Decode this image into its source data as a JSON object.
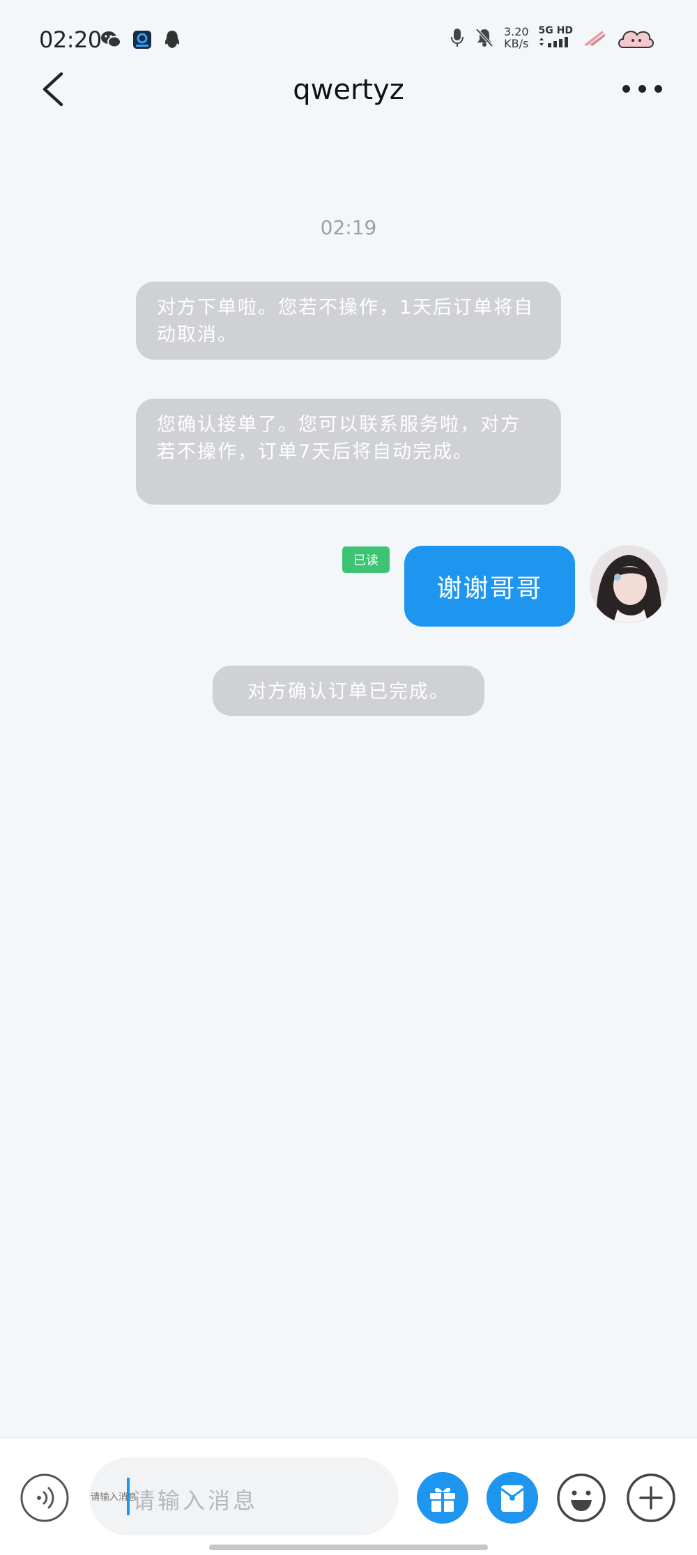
{
  "status_bar": {
    "time": "02:20",
    "speed_value": "3.20",
    "speed_unit": "KB/s",
    "network": "5G HD"
  },
  "header": {
    "title": "qwertyz"
  },
  "chat": {
    "timestamp": "02:19",
    "system_messages": [
      "对方下单啦。您若不操作，1天后订单将自动取消。",
      "您确认接单了。您可以联系服务啦，对方若不操作，订单7天后将自动完成。",
      "对方确认订单已完成。"
    ],
    "my_message": {
      "text": "谢谢哥哥",
      "read_status": "已读"
    }
  },
  "input": {
    "placeholder": "请输入消息"
  },
  "colors": {
    "accent": "#1e96f0",
    "read_badge": "#3cc373",
    "system_bubble": "#cfd1d4",
    "background": "#f4f7fa"
  }
}
